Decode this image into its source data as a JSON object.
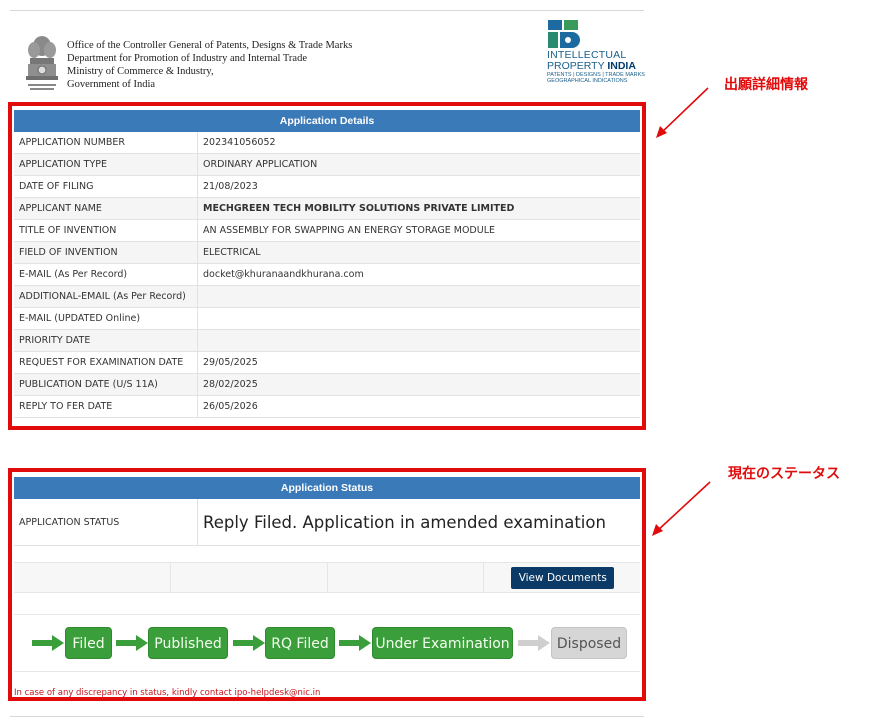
{
  "header": {
    "office_lines": [
      "Office of the Controller General of Patents, Designs & Trade Marks",
      "Department for Promotion of Industry and Internal Trade",
      "Ministry of Commerce & Industry,",
      "Government of India"
    ],
    "ip_logo": {
      "line1": "INTELLECTUAL",
      "line2_a": "PROPERTY ",
      "line2_b": "INDIA",
      "line3": "PATENTS | DESIGNS | TRADE MARKS",
      "line4": "GEOGRAPHICAL INDICATIONS"
    }
  },
  "details": {
    "title": "Application Details",
    "rows": [
      {
        "label": "APPLICATION NUMBER",
        "value": "202341056052"
      },
      {
        "label": "APPLICATION TYPE",
        "value": "ORDINARY APPLICATION"
      },
      {
        "label": "DATE OF FILING",
        "value": "21/08/2023"
      },
      {
        "label": "APPLICANT NAME",
        "value": "MECHGREEN TECH MOBILITY SOLUTIONS PRIVATE LIMITED"
      },
      {
        "label": "TITLE OF INVENTION",
        "value": "AN ASSEMBLY FOR SWAPPING AN ENERGY STORAGE MODULE"
      },
      {
        "label": "FIELD OF INVENTION",
        "value": "ELECTRICAL"
      },
      {
        "label": "E-MAIL (As Per Record)",
        "value": "docket@khuranaandkhurana.com"
      },
      {
        "label": "ADDITIONAL-EMAIL (As Per Record)",
        "value": ""
      },
      {
        "label": "E-MAIL (UPDATED Online)",
        "value": ""
      },
      {
        "label": "PRIORITY DATE",
        "value": ""
      },
      {
        "label": "REQUEST FOR EXAMINATION DATE",
        "value": "29/05/2025"
      },
      {
        "label": "PUBLICATION DATE (U/S 11A)",
        "value": "28/02/2025"
      },
      {
        "label": "REPLY TO FER DATE",
        "value": "26/05/2026"
      }
    ]
  },
  "status": {
    "title": "Application Status",
    "label": "APPLICATION STATUS",
    "value": "Reply Filed. Application in amended examination",
    "view_documents_label": "View Documents",
    "stages": [
      {
        "label": "Filed",
        "state": "done"
      },
      {
        "label": "Published",
        "state": "done"
      },
      {
        "label": "RQ Filed",
        "state": "done"
      },
      {
        "label": "Under Examination",
        "state": "done"
      },
      {
        "label": "Disposed",
        "state": "pending"
      }
    ],
    "contact_note": "In case of any discrepancy in status, kindly contact ipo-helpdesk@nic.in"
  },
  "annotations": {
    "details_label": "出願詳細情報",
    "status_label": "現在のステータス"
  },
  "colors": {
    "highlight_red": "#e10b0b",
    "header_blue": "#3b7ab8",
    "stage_green": "#3a9f3a",
    "stage_grey": "#d6d6d6",
    "button_navy": "#0b3a66"
  }
}
